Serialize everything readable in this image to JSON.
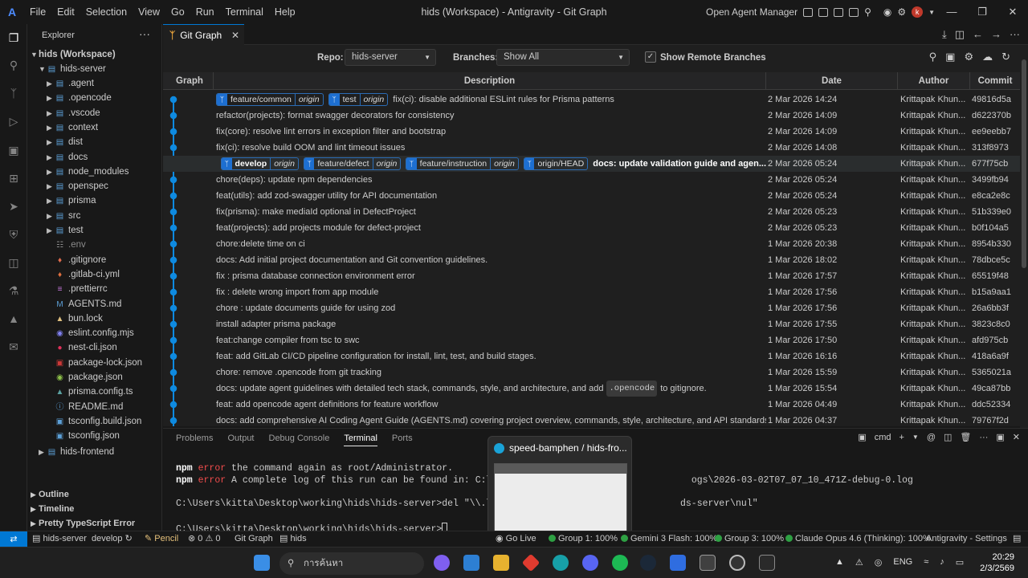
{
  "titlebar": {
    "menu": [
      "File",
      "Edit",
      "Selection",
      "View",
      "Go",
      "Run",
      "Terminal",
      "Help"
    ],
    "title": "hids (Workspace) - Antigravity - Git Graph",
    "agent_manager": "Open Agent Manager",
    "avatar_letter": "k"
  },
  "sidebar": {
    "header": "Explorer",
    "workspace": "hids (Workspace)",
    "root_folder": "hids-server",
    "items": [
      {
        "label": ".agent",
        "type": "folder"
      },
      {
        "label": ".opencode",
        "type": "folder"
      },
      {
        "label": ".vscode",
        "type": "folder"
      },
      {
        "label": "context",
        "type": "folder"
      },
      {
        "label": "dist",
        "type": "folder"
      },
      {
        "label": "docs",
        "type": "folder"
      },
      {
        "label": "node_modules",
        "type": "folder"
      },
      {
        "label": "openspec",
        "type": "folder"
      },
      {
        "label": "prisma",
        "type": "folder"
      },
      {
        "label": "src",
        "type": "folder"
      },
      {
        "label": "test",
        "type": "folder"
      },
      {
        "label": ".env",
        "type": "file"
      },
      {
        "label": ".gitignore",
        "type": "file"
      },
      {
        "label": ".gitlab-ci.yml",
        "type": "file"
      },
      {
        "label": ".prettierrc",
        "type": "file"
      },
      {
        "label": "AGENTS.md",
        "type": "file"
      },
      {
        "label": "bun.lock",
        "type": "file"
      },
      {
        "label": "eslint.config.mjs",
        "type": "file"
      },
      {
        "label": "nest-cli.json",
        "type": "file"
      },
      {
        "label": "package-lock.json",
        "type": "file"
      },
      {
        "label": "package.json",
        "type": "file"
      },
      {
        "label": "prisma.config.ts",
        "type": "file"
      },
      {
        "label": "README.md",
        "type": "file"
      },
      {
        "label": "tsconfig.build.json",
        "type": "file"
      },
      {
        "label": "tsconfig.json",
        "type": "file"
      }
    ],
    "second_folder": "hids-frontend",
    "sections": [
      "Outline",
      "Timeline",
      "Pretty TypeScript Error"
    ]
  },
  "tab": {
    "label": "Git Graph"
  },
  "controls": {
    "repo_label": "Repo:",
    "repo_value": "hids-server",
    "branches_label": "Branches:",
    "branches_value": "Show All",
    "remote_label": "Show Remote Branches"
  },
  "table": {
    "headers": {
      "graph": "Graph",
      "description": "Description",
      "date": "Date",
      "author": "Author",
      "commit": "Commit"
    },
    "rows": [
      {
        "refs": [
          {
            "name": "feature/common",
            "remote": "origin"
          },
          {
            "name": "test",
            "remote": "origin"
          }
        ],
        "msg": "fix(ci): disable additional ESLint rules for Prisma patterns",
        "date": "2 Mar 2026 14:24",
        "author": "Krittapak Khun...",
        "hash": "49816d5a"
      },
      {
        "refs": [],
        "msg": "refactor(projects): format swagger decorators for consistency",
        "date": "2 Mar 2026 14:09",
        "author": "Krittapak Khun...",
        "hash": "d622370b"
      },
      {
        "refs": [],
        "msg": "fix(core): resolve lint errors in exception filter and bootstrap",
        "date": "2 Mar 2026 14:09",
        "author": "Krittapak Khun...",
        "hash": "ee9eebb7"
      },
      {
        "refs": [],
        "msg": "fix(ci): resolve build OOM and lint timeout issues",
        "date": "2 Mar 2026 14:08",
        "author": "Krittapak Khun...",
        "hash": "313f8973"
      },
      {
        "refs": [
          {
            "name": "develop",
            "remote": "origin",
            "current": true
          },
          {
            "name": "feature/defect",
            "remote": "origin"
          },
          {
            "name": "feature/instruction",
            "remote": "origin"
          },
          {
            "name": "origin/HEAD",
            "remote": ""
          }
        ],
        "msg": "docs: update validation guide and agen...",
        "bold": true,
        "date": "2 Mar 2026 05:24",
        "author": "Krittapak Khun...",
        "hash": "677f75cb"
      },
      {
        "refs": [],
        "msg": "chore(deps): update npm dependencies",
        "date": "2 Mar 2026 05:24",
        "author": "Krittapak Khun...",
        "hash": "3499fb94"
      },
      {
        "refs": [],
        "msg": "feat(utils): add zod-swagger utility for API documentation",
        "date": "2 Mar 2026 05:24",
        "author": "Krittapak Khun...",
        "hash": "e8ca2e8c"
      },
      {
        "refs": [],
        "msg": "fix(prisma): make mediaId optional in DefectProject",
        "date": "2 Mar 2026 05:23",
        "author": "Krittapak Khun...",
        "hash": "51b339e0"
      },
      {
        "refs": [],
        "msg": "feat(projects): add projects module for defect-project",
        "date": "2 Mar 2026 05:23",
        "author": "Krittapak Khun...",
        "hash": "b0f104a5"
      },
      {
        "refs": [],
        "msg": "chore:delete time on ci",
        "date": "1 Mar 2026 20:38",
        "author": "Krittapak Khun...",
        "hash": "8954b330"
      },
      {
        "refs": [],
        "msg": "docs: Add initial project documentation and Git convention guidelines.",
        "date": "1 Mar 2026 18:02",
        "author": "Krittapak Khun...",
        "hash": "78dbce5c"
      },
      {
        "refs": [],
        "msg": "fix : prisma database connection environment error",
        "date": "1 Mar 2026 17:57",
        "author": "Krittapak Khun...",
        "hash": "65519f48"
      },
      {
        "refs": [],
        "msg": "fix : delete wrong import from app module",
        "date": "1 Mar 2026 17:56",
        "author": "Krittapak Khun...",
        "hash": "b15a9aa1"
      },
      {
        "refs": [],
        "msg": "chore : update documents guide for using zod",
        "date": "1 Mar 2026 17:56",
        "author": "Krittapak Khun...",
        "hash": "26a6bb3f"
      },
      {
        "refs": [],
        "msg": "install adapter prisma package",
        "date": "1 Mar 2026 17:55",
        "author": "Krittapak Khun...",
        "hash": "3823c8c0"
      },
      {
        "refs": [],
        "msg": "feat:change compiler from tsc to swc",
        "date": "1 Mar 2026 17:50",
        "author": "Krittapak Khun...",
        "hash": "afd975cb"
      },
      {
        "refs": [],
        "msg": "feat: add GitLab CI/CD pipeline configuration for install, lint, test, and build stages.",
        "date": "1 Mar 2026 16:16",
        "author": "Krittapak Khun...",
        "hash": "418a6a9f"
      },
      {
        "refs": [],
        "msg": "chore: remove .opencode from git tracking",
        "date": "1 Mar 2026 15:59",
        "author": "Krittapak Khun...",
        "hash": "5365021a"
      },
      {
        "refs": [],
        "msg_pre": "docs: update agent guidelines with detailed tech stack, commands, style, and architecture, and add",
        "code": ".opencode",
        "msg_post": "to gitignore.",
        "date": "1 Mar 2026 15:54",
        "author": "Krittapak Khun...",
        "hash": "49ca87bb"
      },
      {
        "refs": [],
        "msg": "feat: add opencode agent definitions for feature workflow",
        "date": "1 Mar 2026 04:49",
        "author": "Krittapak Khun...",
        "hash": "ddc52334"
      },
      {
        "refs": [],
        "msg": "docs: add comprehensive AI Coding Agent Guide (AGENTS.md) covering project overview, commands, style, architecture, and API standards.",
        "date": "1 Mar 2026 04:37",
        "author": "Krittapak Khun...",
        "hash": "79767f2d"
      }
    ]
  },
  "panel": {
    "tabs": [
      "Problems",
      "Output",
      "Debug Console",
      "Terminal",
      "Ports"
    ],
    "active_tab": "Terminal",
    "shell": "cmd",
    "lines": [
      {
        "npm": "npm",
        "err": "error",
        "text": " the command again as root/Administrator."
      },
      {
        "npm": "npm",
        "err": "error",
        "text": " A complete log of this run can be found in: C:\\Users\\ki                            ogs\\2026-03-02T07_07_10_471Z-debug-0.log"
      },
      {
        "text": ""
      },
      {
        "text": "C:\\Users\\kitta\\Desktop\\working\\hids\\hids-server>del \"\\\\.\\c:\\Users                          ds-server\\nul\""
      },
      {
        "text": ""
      },
      {
        "text": "C:\\Users\\kitta\\Desktop\\working\\hids\\hids-server>"
      }
    ]
  },
  "preview": {
    "title": "speed-bamphen / hids-fro..."
  },
  "statusbar": {
    "branch_folder": "hids-server",
    "branch": "develop",
    "pencil": "Pencil",
    "errors": "0",
    "warnings": "0",
    "git_graph": "Git Graph",
    "folder": "hids",
    "go_live": "Go Live",
    "group1": "Group 1: 100%",
    "gemini": "Gemini 3 Flash: 100%",
    "group3": "Group 3: 100%",
    "claude": "Claude Opus 4.6 (Thinking): 100%",
    "settings": "Antigravity - Settings"
  },
  "taskbar": {
    "search_placeholder": "การค้นหา",
    "lang": "ENG",
    "time": "20:29",
    "date": "2/3/2569"
  },
  "colors": {
    "accent": "#0078d4",
    "graph_line": "#0e8ae0",
    "branch_badge": "#1d6fd1"
  }
}
